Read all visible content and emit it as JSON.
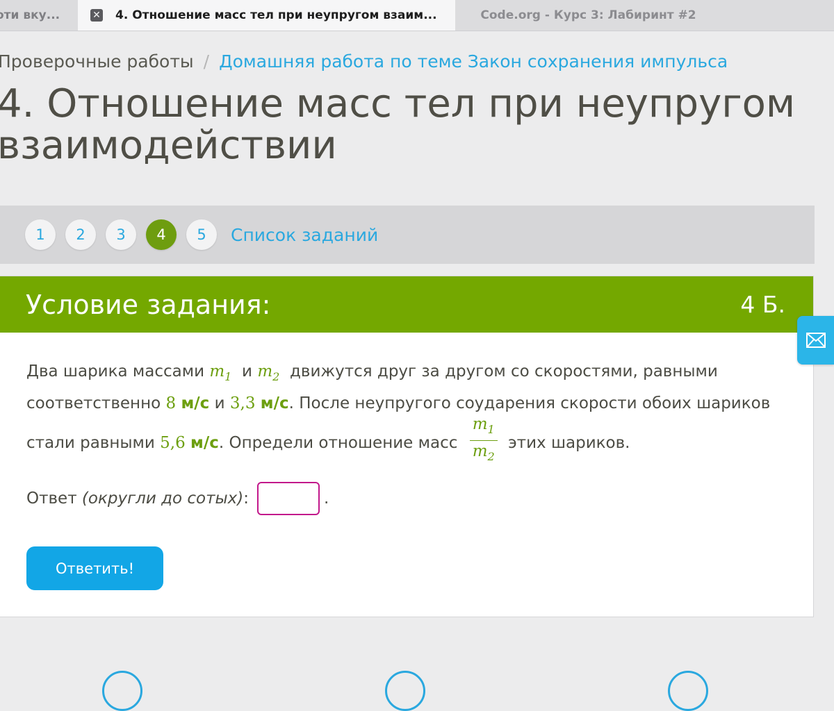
{
  "browser": {
    "tabs": [
      {
        "title": "оти вку..."
      },
      {
        "title": "4. Отношение масс тел при неупругом взаим..."
      },
      {
        "title": "Code.org - Курс 3: Лабиринт #2"
      }
    ],
    "close_glyph": "✕"
  },
  "breadcrumb": {
    "first": "Проверочные работы",
    "separator": "/",
    "second": "Домашняя работа по теме Закон сохранения импульса"
  },
  "page_title": "4. Отношение масс тел при неупругом взаимодействии",
  "task_nav": {
    "items": [
      "1",
      "2",
      "3",
      "4",
      "5"
    ],
    "active_index": 3,
    "list_link": "Список заданий"
  },
  "card": {
    "title": "Условие задания:",
    "points": "4 Б."
  },
  "problem": {
    "part1": "Два шарика массами",
    "m": "m",
    "sub1": "1",
    "and": "и",
    "sub2": "2",
    "part2": "движутся друг за другом со скоростями, равными соответственно",
    "v1_num": "8",
    "unit": "м/с",
    "and2": "и",
    "v2_num": "3,3",
    "part3": ". После неупругого соударения скорости обоих шариков стали равными",
    "v3_num": "5,6",
    "part4": ". Определи отношение масс",
    "part5": "этих шариков."
  },
  "answer": {
    "label": "Ответ",
    "hint": "(округли до сотых)",
    "colon": ":",
    "dot": ".",
    "value": ""
  },
  "submit_label": "Ответить!",
  "colors": {
    "accent_green": "#74a800",
    "link_blue": "#2aa8df",
    "button_blue": "#12a6e6",
    "input_border": "#c2188b"
  },
  "icons": {
    "mail": "mail-icon",
    "tab_close": "close-icon"
  }
}
